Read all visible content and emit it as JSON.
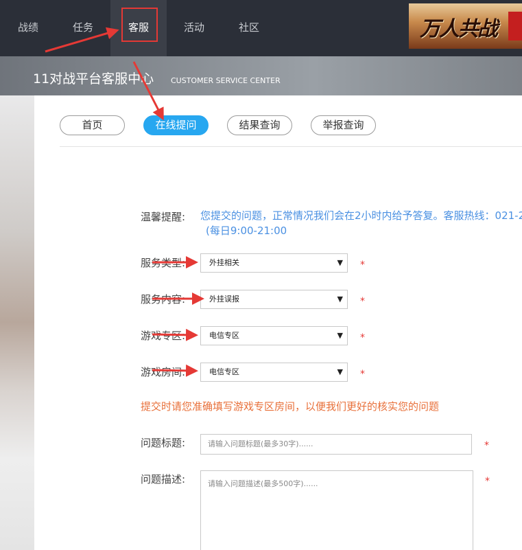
{
  "nav": {
    "items": [
      {
        "label": "战绩"
      },
      {
        "label": "任务"
      },
      {
        "label": "客服"
      },
      {
        "label": "活动"
      },
      {
        "label": "社区"
      }
    ],
    "banner_text": "万人共战"
  },
  "header": {
    "title": "11对战平台客服中心",
    "subtitle": "CUSTOMER SERVICE CENTER"
  },
  "tabs": [
    {
      "label": "首页"
    },
    {
      "label": "在线提问"
    },
    {
      "label": "结果查询"
    },
    {
      "label": "举报查询"
    }
  ],
  "form": {
    "tip_label": "温馨提醒:",
    "tip_text": "您提交的问题，正常情况我们会在2小时内给予答复。客服热线：021-2",
    "tip_hours": "(每日9:00-21:00",
    "service_type": {
      "label": "服务类型:",
      "value": "外挂相关"
    },
    "service_content": {
      "label": "服务内容:",
      "value": "外挂误报"
    },
    "game_zone": {
      "label": "游戏专区:",
      "value": "电信专区"
    },
    "game_room": {
      "label": "游戏房间:",
      "value": "电信专区"
    },
    "warning": "提交时请您准确填写游戏专区房间，以便我们更好的核实您的问题",
    "question_title": {
      "label": "问题标题:",
      "placeholder": "请输入问题标题(最多30字)......"
    },
    "question_desc": {
      "label": "问题描述:",
      "placeholder": "请输入问题描述(最多500字)......"
    },
    "required_mark": "*"
  },
  "colors": {
    "accent": "#27a7f0",
    "annotation": "#e53935",
    "warning": "#e8703a",
    "tip": "#4a90e2"
  }
}
